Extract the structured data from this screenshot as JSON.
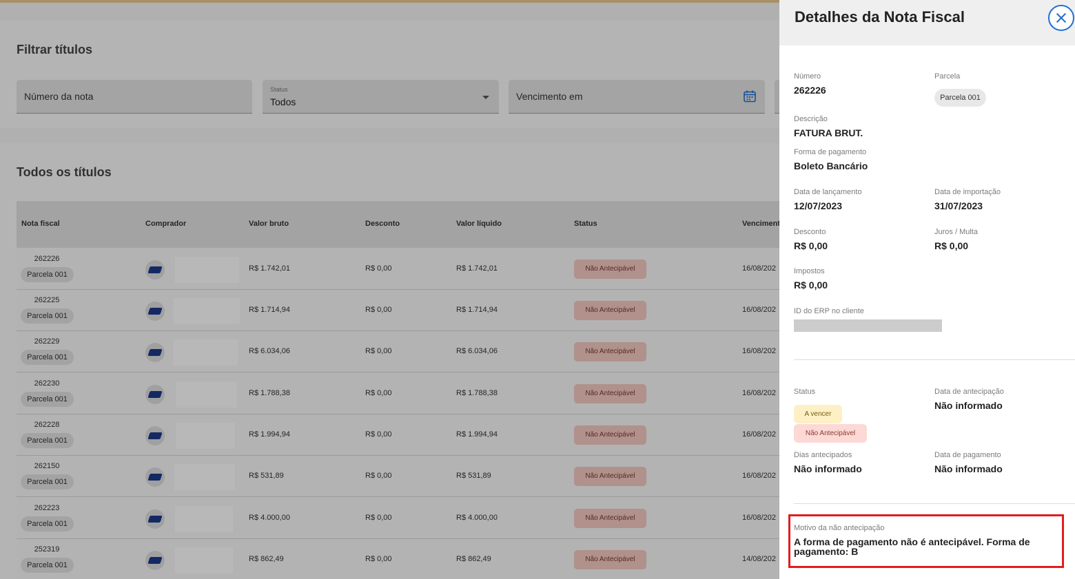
{
  "filters": {
    "title": "Filtrar títulos",
    "numero_nota_placeholder": "Número da nota",
    "status_label": "Status",
    "status_value": "Todos",
    "vencimento_placeholder": "Vencimento em"
  },
  "table": {
    "title": "Todos os títulos",
    "columns": [
      "Nota fiscal",
      "Comprador",
      "Valor bruto",
      "Desconto",
      "Valor líquido",
      "Status",
      "Venciment"
    ],
    "rows": [
      {
        "nota": "262226",
        "parcela": "Parcela 001",
        "bruto": "R$ 1.742,01",
        "desconto": "R$ 0,00",
        "liquido": "R$ 1.742,01",
        "status": "Não Antecipável",
        "venc": "16/08/202"
      },
      {
        "nota": "262225",
        "parcela": "Parcela 001",
        "bruto": "R$ 1.714,94",
        "desconto": "R$ 0,00",
        "liquido": "R$ 1.714,94",
        "status": "Não Antecipável",
        "venc": "16/08/202"
      },
      {
        "nota": "262229",
        "parcela": "Parcela 001",
        "bruto": "R$ 6.034,06",
        "desconto": "R$ 0,00",
        "liquido": "R$ 6.034,06",
        "status": "Não Antecipável",
        "venc": "16/08/202"
      },
      {
        "nota": "262230",
        "parcela": "Parcela 001",
        "bruto": "R$ 1.788,38",
        "desconto": "R$ 0,00",
        "liquido": "R$ 1.788,38",
        "status": "Não Antecipável",
        "venc": "16/08/202"
      },
      {
        "nota": "262228",
        "parcela": "Parcela 001",
        "bruto": "R$ 1.994,94",
        "desconto": "R$ 0,00",
        "liquido": "R$ 1.994,94",
        "status": "Não Antecipável",
        "venc": "16/08/202"
      },
      {
        "nota": "262150",
        "parcela": "Parcela 001",
        "bruto": "R$ 531,89",
        "desconto": "R$ 0,00",
        "liquido": "R$ 531,89",
        "status": "Não Antecipável",
        "venc": "16/08/202"
      },
      {
        "nota": "262223",
        "parcela": "Parcela 001",
        "bruto": "R$ 4.000,00",
        "desconto": "R$ 0,00",
        "liquido": "R$ 4.000,00",
        "status": "Não Antecipável",
        "venc": "16/08/202"
      },
      {
        "nota": "252319",
        "parcela": "Parcela 001",
        "bruto": "R$ 862,49",
        "desconto": "R$ 0,00",
        "liquido": "R$ 862,49",
        "status": "Não Antecipável",
        "venc": "14/08/202"
      }
    ]
  },
  "drawer": {
    "title": "Detalhes da Nota Fiscal",
    "numero_label": "Número",
    "numero_value": "262226",
    "parcela_label": "Parcela",
    "parcela_value": "Parcela 001",
    "descricao_label": "Descrição",
    "descricao_value": "FATURA BRUT.",
    "forma_label": "Forma de pagamento",
    "forma_value": "Boleto Bancário",
    "lancamento_label": "Data de lançamento",
    "lancamento_value": "12/07/2023",
    "importacao_label": "Data de importação",
    "importacao_value": "31/07/2023",
    "desconto_label": "Desconto",
    "desconto_value": "R$ 0,00",
    "juros_label": "Juros / Multa",
    "juros_value": "R$ 0,00",
    "impostos_label": "Impostos",
    "impostos_value": "R$ 0,00",
    "erp_label": "ID do ERP no cliente",
    "status_label": "Status",
    "status_badges": [
      "A vencer",
      "Não Antecipável"
    ],
    "antecipacao_label": "Data de antecipação",
    "antecipacao_value": "Não informado",
    "dias_label": "Dias antecipados",
    "dias_value": "Não informado",
    "pagamento_label": "Data de pagamento",
    "pagamento_value": "Não informado",
    "motivo_label": "Motivo da não antecipação",
    "motivo_value": "A forma de pagamento não é antecipável. Forma de pagamento: B"
  },
  "colors": {
    "accent": "#1f6fd1",
    "highlight_border": "#e11d1d",
    "status_red_bg": "#f4c9c2",
    "status_yellow_bg": "#fdf0c4"
  }
}
